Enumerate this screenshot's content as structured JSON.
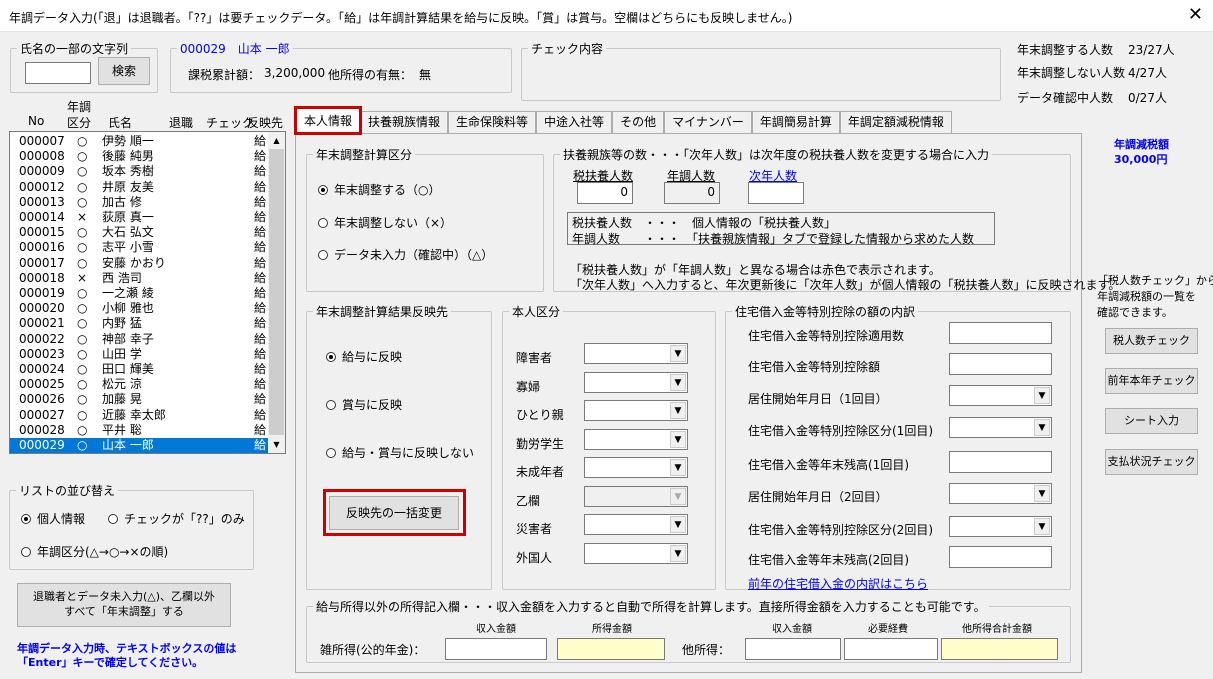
{
  "window": {
    "title": "年調データ入力(「退」は退職者。「??」は要チェックデータ。「給」は年調計算結果を給与に反映。「賞」は賞与。空欄はどちらにも反映しません。)",
    "close_glyph": "✕"
  },
  "name_search": {
    "legend": "氏名の一部の文字列",
    "value": "",
    "button": "検索"
  },
  "employee_header": {
    "legend": "000029　山本 一郎",
    "taxable_label": "課税累計額：",
    "taxable_value": "3,200,000",
    "other_income_label": "他所得の有無：",
    "other_income_value": "無"
  },
  "check_content": {
    "legend": "チェック内容"
  },
  "stats": [
    {
      "label": "年末調整する人数",
      "value": "23/27人"
    },
    {
      "label": "年末調整しない人数",
      "value": "4/27人"
    },
    {
      "label": "データ確認中人数",
      "value": "0/27人"
    }
  ],
  "list_headers": {
    "no": "No",
    "kubun_top": "年調",
    "kubun_bottom": "区分",
    "name": "氏名",
    "retired": "退職",
    "check": "チェック",
    "dest": "反映先"
  },
  "employees": [
    {
      "no": "000007",
      "k": "○",
      "name": "伊勢 順一",
      "dest": "給"
    },
    {
      "no": "000008",
      "k": "○",
      "name": "後藤 純男",
      "dest": "給"
    },
    {
      "no": "000009",
      "k": "○",
      "name": "坂本 秀樹",
      "dest": "給"
    },
    {
      "no": "000012",
      "k": "○",
      "name": "井原 友美",
      "dest": "給"
    },
    {
      "no": "000013",
      "k": "○",
      "name": "加古 修",
      "dest": "給"
    },
    {
      "no": "000014",
      "k": "×",
      "name": "荻原 真一",
      "dest": "給"
    },
    {
      "no": "000015",
      "k": "○",
      "name": "大石 弘文",
      "dest": "給"
    },
    {
      "no": "000016",
      "k": "○",
      "name": "志平 小雪",
      "dest": "給"
    },
    {
      "no": "000017",
      "k": "○",
      "name": "安藤 かおり",
      "dest": "給"
    },
    {
      "no": "000018",
      "k": "×",
      "name": "西 浩司",
      "dest": "給"
    },
    {
      "no": "000019",
      "k": "○",
      "name": "一之瀬 綾",
      "dest": "給"
    },
    {
      "no": "000020",
      "k": "○",
      "name": "小柳 雅也",
      "dest": "給"
    },
    {
      "no": "000021",
      "k": "○",
      "name": "内野 猛",
      "dest": "給"
    },
    {
      "no": "000022",
      "k": "○",
      "name": "神部 幸子",
      "dest": "給"
    },
    {
      "no": "000023",
      "k": "○",
      "name": "山田 学",
      "dest": "給"
    },
    {
      "no": "000024",
      "k": "○",
      "name": "田口 輝美",
      "dest": "給"
    },
    {
      "no": "000025",
      "k": "○",
      "name": "松元 涼",
      "dest": "給"
    },
    {
      "no": "000026",
      "k": "○",
      "name": "加藤 晃",
      "dest": "給"
    },
    {
      "no": "000027",
      "k": "○",
      "name": "近藤 幸太郎",
      "dest": "給"
    },
    {
      "no": "000028",
      "k": "○",
      "name": "平井 聡",
      "dest": "給"
    },
    {
      "no": "000029",
      "k": "○",
      "name": "山本 一郎",
      "dest": "給"
    }
  ],
  "sort": {
    "legend": "リストの並び替え",
    "opt_personal": "個人情報",
    "opt_check": "チェックが「??」のみ",
    "opt_kubun": "年調区分(△→○→×の順)"
  },
  "bulk_button": {
    "line1": "退職者とデータ未入力(△)、乙欄以外",
    "line2": "すべて「年末調整」する"
  },
  "bottom_note": {
    "line1": "年調データ入力時、テキストボックスの値は",
    "line2": "「Enter」キーで確定してください。"
  },
  "tabs": [
    "本人情報",
    "扶養親族情報",
    "生命保険料等",
    "中途入社等",
    "その他",
    "マイナンバー",
    "年調簡易計算",
    "年調定額減税情報"
  ],
  "calc_kubun": {
    "legend": "年末調整計算区分",
    "opt_do": "年末調整する（○）",
    "opt_dont": "年末調整しない（×）",
    "opt_pending": "データ未入力（確認中）（△）"
  },
  "dependents": {
    "legend": "扶養親族等の数・・・「次年人数」は次年度の税扶養人数を変更する場合に入力",
    "col_tax": "税扶養人数",
    "col_nencho": "年調人数",
    "col_next": "次年人数",
    "val_tax": "0",
    "val_nencho": "0",
    "val_next": "",
    "info_line1": "税扶養人数　・・・　個人情報の「税扶養人数」",
    "info_line2": "年調人数　　・・・　「扶養親族情報」タブで登録した情報から求めた人数",
    "note_line1": "「税扶養人数」が「年調人数」と異なる場合は赤色で表示されます。",
    "note_line2": "「次年人数」へ入力すると、年次更新後に「次年人数」が個人情報の「税扶養人数」に反映されます。"
  },
  "result_dest": {
    "legend": "年末調整計算結果反映先",
    "opt_salary": "給与に反映",
    "opt_bonus": "賞与に反映",
    "opt_none": "給与・賞与に反映しない",
    "bulk_change": "反映先の一括変更"
  },
  "person_kubun": {
    "legend": "本人区分",
    "items": [
      "障害者",
      "寡婦",
      "ひとり親",
      "勤労学生",
      "未成年者",
      "乙欄",
      "災害者",
      "外国人"
    ]
  },
  "housing_loan": {
    "legend": "住宅借入金等特別控除の額の内訳",
    "items": [
      "住宅借入金等特別控除適用数",
      "住宅借入金等特別控除額",
      "居住開始年月日（1回目）",
      "住宅借入金等特別控除区分(1回目)",
      "住宅借入金等年末残高(1回目)",
      "居住開始年月日（2回目）",
      "住宅借入金等特別控除区分(2回目)",
      "住宅借入金等年末残高(2回目)"
    ],
    "link": "前年の住宅借入金の内訳はこちら"
  },
  "other_income": {
    "legend": "給与所得以外の所得記入欄・・・収入金額を入力すると自動で所得を計算します。直接所得金額を入力することも可能です。",
    "misc_label": "雑所得(公的年金)：",
    "other_label": "他所得：",
    "col_revenue": "収入金額",
    "col_income": "所得金額",
    "col_revenue2": "収入金額",
    "col_expense": "必要経費",
    "col_total": "他所得合計金額"
  },
  "right_panel": {
    "reduction_label": "年調減税額",
    "reduction_value": "30,000円",
    "note_line1": "「税人数チェック」から",
    "note_line2": "年調減税額の一覧を",
    "note_line3": "確認できます。",
    "btn_taxcount": "税人数チェック",
    "btn_prev_year": "前年本年チェック",
    "btn_sheet": "シート入力",
    "btn_payment": "支払状況チェック"
  },
  "colors": {
    "highlight_red": "#cc0000",
    "selection_blue": "#0078d7",
    "label_blue": "#0000ff",
    "readonly_yellow": "#ffffcc"
  }
}
